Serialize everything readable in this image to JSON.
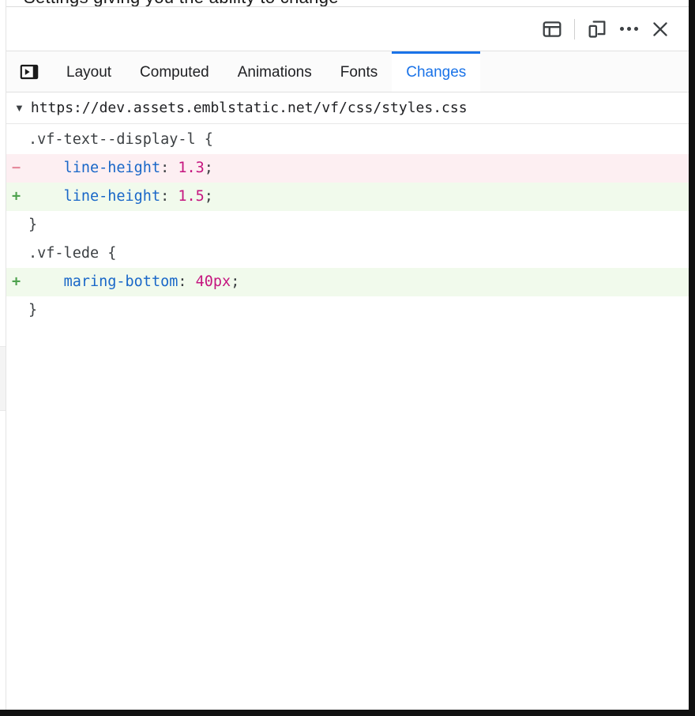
{
  "window": {
    "clipped_page_text": "Settings  giving  you  the  ability  to  change"
  },
  "toolbar": {
    "dock_side_label": "Dock side",
    "device_toolbar_label": "Toggle device toolbar",
    "more_options_label": "More options",
    "close_label": "Close DevTools",
    "close_glyph": "✕"
  },
  "tabs": {
    "panel_toggle_label": "Show drawer",
    "items": [
      {
        "label": "Layout",
        "active": false
      },
      {
        "label": "Computed",
        "active": false
      },
      {
        "label": "Animations",
        "active": false
      },
      {
        "label": "Fonts",
        "active": false
      },
      {
        "label": "Changes",
        "active": true
      }
    ],
    "active_color": "#1a73e8"
  },
  "file": {
    "disclosure_glyph": "▼",
    "path": "https://dev.assets.emblstatic.net/vf/css/styles.css",
    "expanded": true
  },
  "diff": {
    "removed_bg": "#fdeff2",
    "added_bg": "#f1faec",
    "removed_marker_color": "#e58a9c",
    "added_marker_color": "#4ea24e",
    "property_color": "#1967c8",
    "value_color": "#c5167f",
    "lines": [
      {
        "type": "context",
        "marker": "",
        "indent": "",
        "selector": ".vf-text--display-l {",
        "prop": "",
        "value": ""
      },
      {
        "type": "removed",
        "marker": "−",
        "indent": "    ",
        "selector": "",
        "prop": "line-height",
        "value": "1.3"
      },
      {
        "type": "added",
        "marker": "+",
        "indent": "    ",
        "selector": "",
        "prop": "line-height",
        "value": "1.5"
      },
      {
        "type": "context",
        "marker": "",
        "indent": "",
        "selector": "}",
        "prop": "",
        "value": ""
      },
      {
        "type": "context",
        "marker": "",
        "indent": "",
        "selector": ".vf-lede {",
        "prop": "",
        "value": ""
      },
      {
        "type": "added",
        "marker": "+",
        "indent": "    ",
        "selector": "",
        "prop": "maring-bottom",
        "value": "40px"
      },
      {
        "type": "context",
        "marker": "",
        "indent": "",
        "selector": "}",
        "prop": "",
        "value": ""
      }
    ]
  }
}
